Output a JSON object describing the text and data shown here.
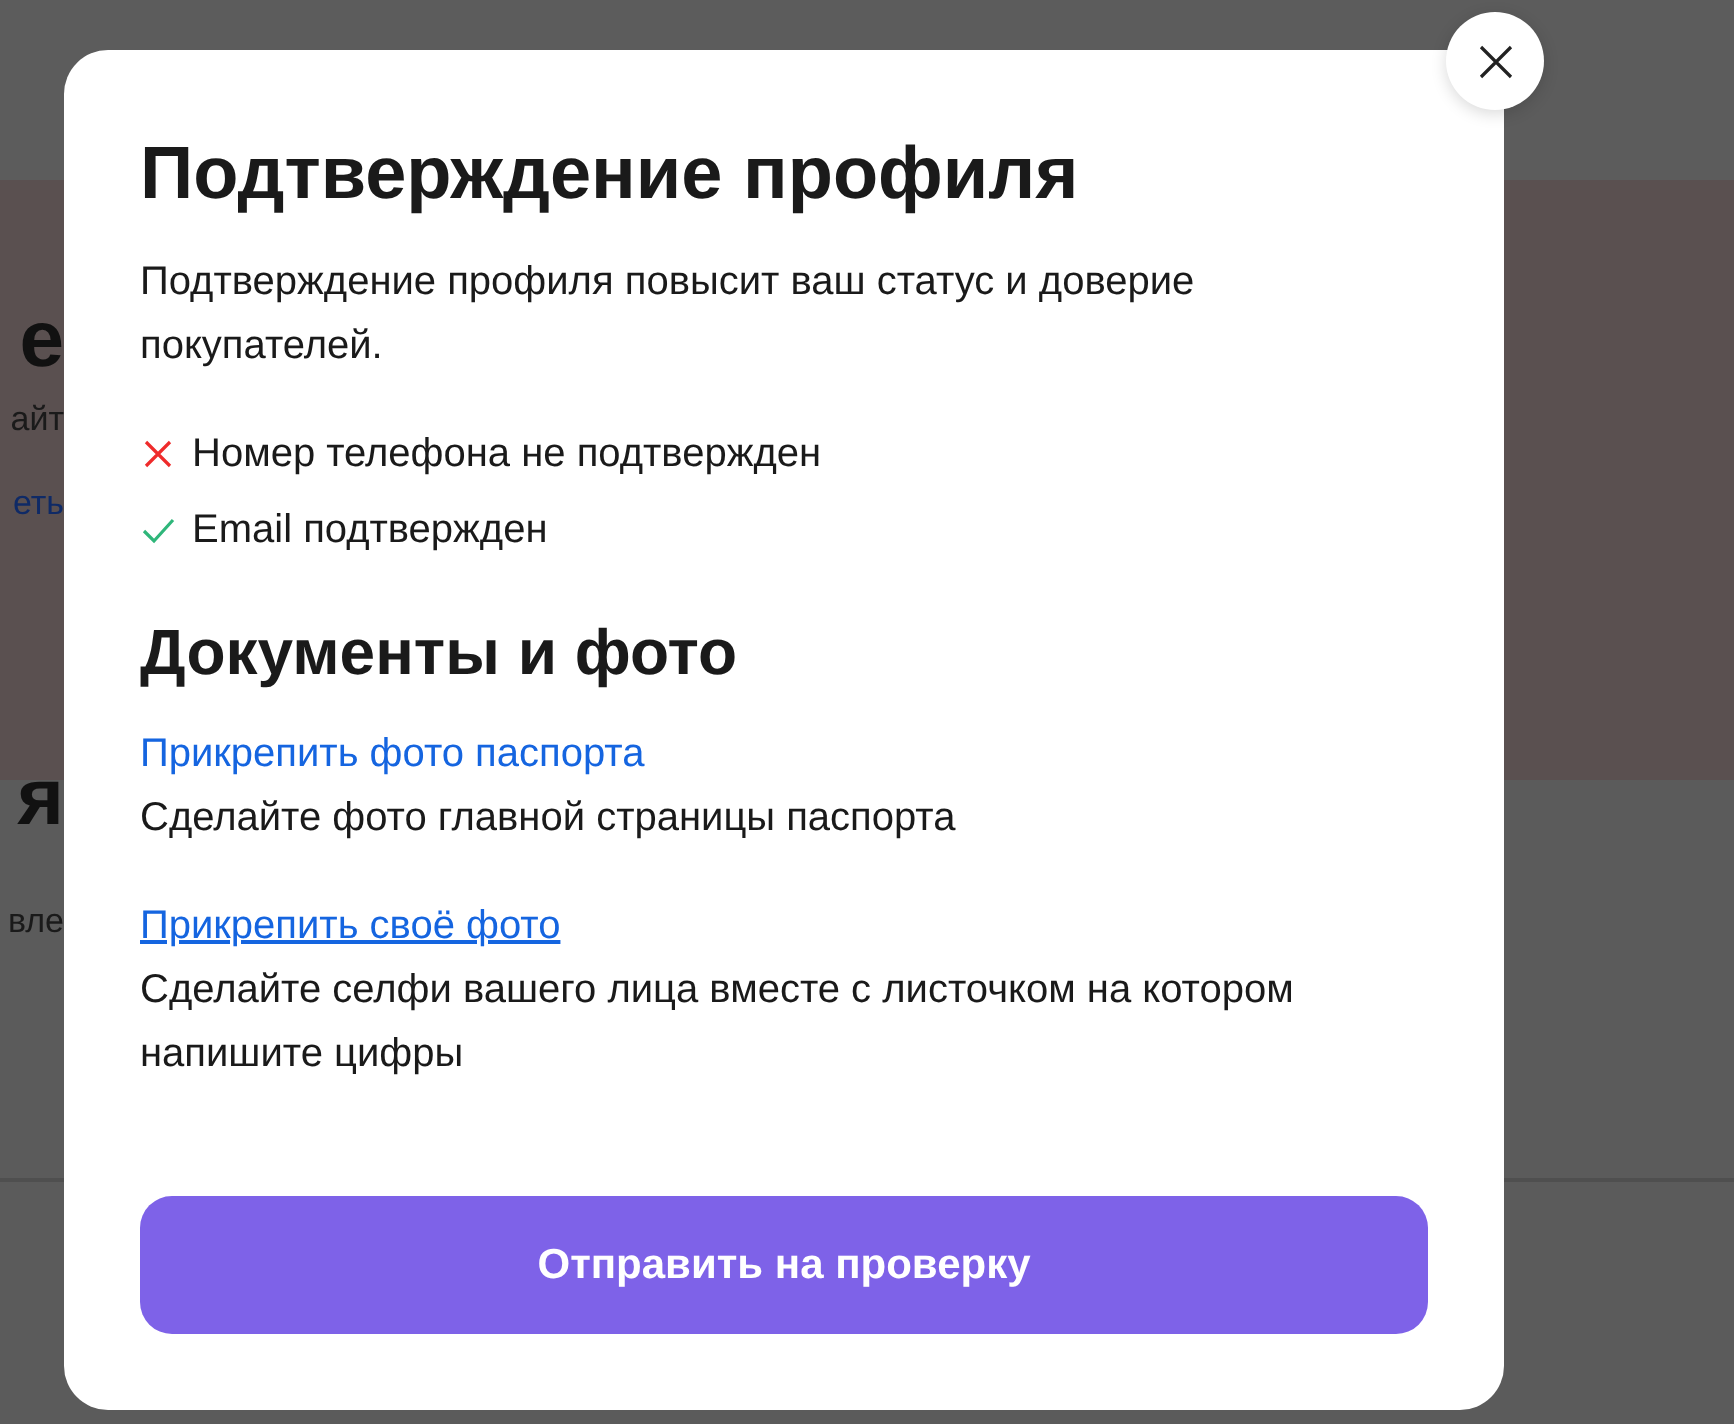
{
  "banner": {
    "heading": "е",
    "text": "айт",
    "link": "еть"
  },
  "section": {
    "heading": "я",
    "text": "вле"
  },
  "modal": {
    "title": "Подтверждение профиля",
    "description": "Подтверждение профиля повысит ваш статус и доверие покупателей.",
    "checks": [
      {
        "label": "Номер телефона не подтвержден",
        "verified": false
      },
      {
        "label": "Email подтвержден",
        "verified": true
      }
    ],
    "documents_title": "Документы и фото",
    "documents": [
      {
        "link": "Прикрепить фото паспорта",
        "hint": "Сделайте фото главной страницы паспорта",
        "hovered": false
      },
      {
        "link": "Прикрепить своё фото",
        "hint": "Сделайте селфи вашего лица вместе с листочком на котором напишите цифры",
        "hovered": true
      }
    ],
    "submit": "Отправить на проверку"
  }
}
